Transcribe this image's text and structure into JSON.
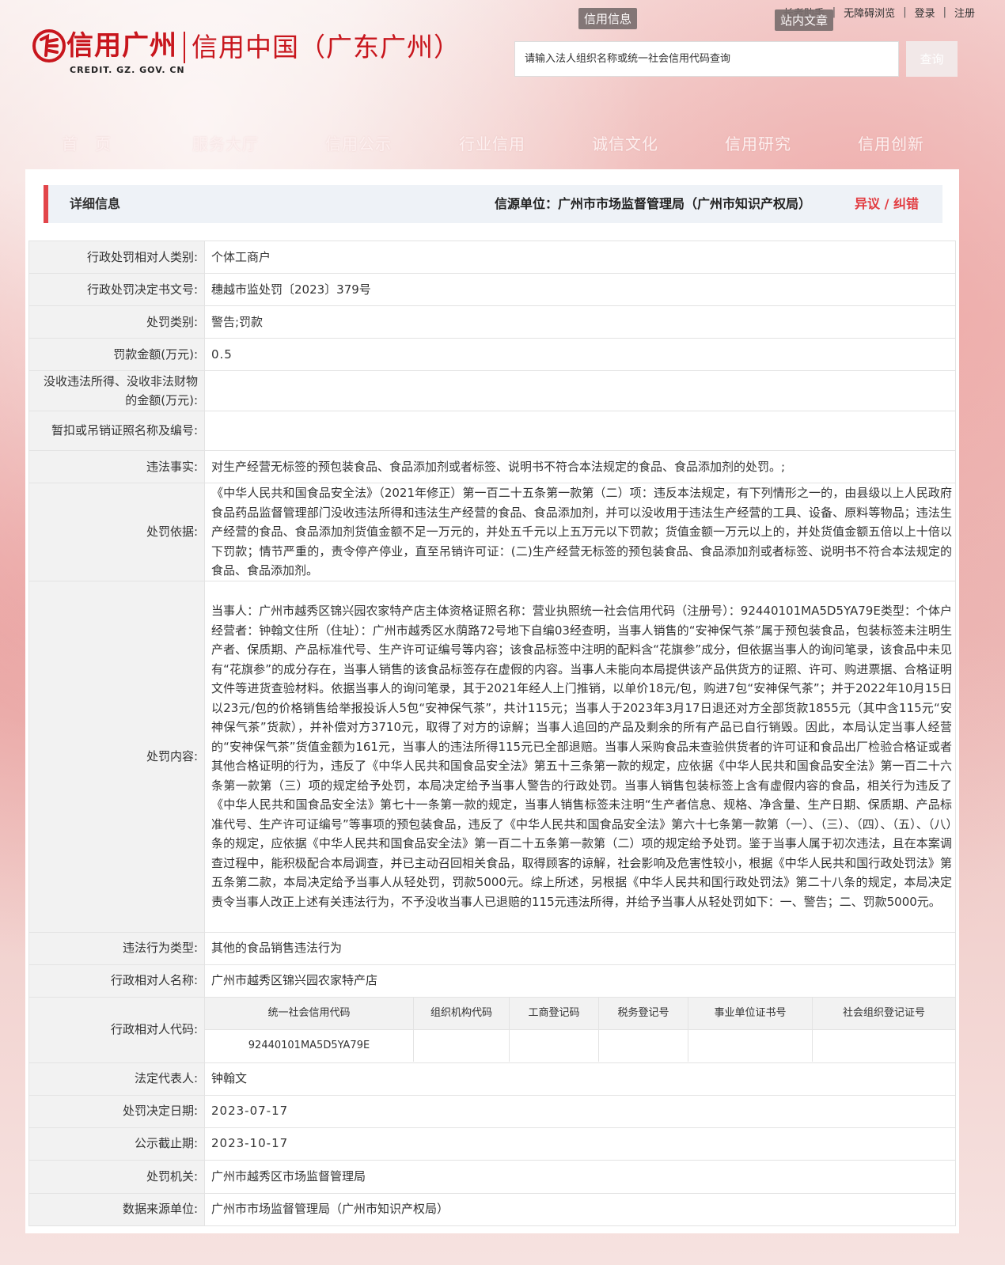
{
  "top_links": {
    "elder": "长者助手",
    "barrier_free": "无障碍浏览",
    "login": "登录",
    "register": "注册"
  },
  "tags": {
    "credit_info": "信用信息",
    "site_article": "站内文章"
  },
  "logo": {
    "cn": "信用广州",
    "en": "CREDIT. GZ. GOV. CN",
    "subtitle": "信用中国（广东广州）"
  },
  "search": {
    "placeholder": "请输入法人组织名称或统一社会信用代码查询",
    "button": "查询"
  },
  "nav": [
    "首　页",
    "服务大厅",
    "信用公示",
    "行业信用",
    "诚信文化",
    "信用研究",
    "信用创新"
  ],
  "header": {
    "title": "详细信息",
    "source": "信源单位：广州市市场监督管理局（广州市知识产权局）",
    "objection": "异议 / 纠错"
  },
  "rows": {
    "r1": {
      "label": "行政处罚相对人类别:",
      "value": "个体工商户"
    },
    "r2": {
      "label": "行政处罚决定书文号:",
      "value": "穗越市监处罚〔2023〕379号"
    },
    "r3": {
      "label": "处罚类别:",
      "value": "警告;罚款"
    },
    "r4": {
      "label": "罚款金额(万元):",
      "value": "0.5"
    },
    "r5": {
      "label": "没收违法所得、没收非法财物的金额(万元):",
      "value": ""
    },
    "r6": {
      "label": "暂扣或吊销证照名称及编号:",
      "value": ""
    },
    "r7": {
      "label": "违法事实:",
      "value": "对生产经营无标签的预包装食品、食品添加剂或者标签、说明书不符合本法规定的食品、食品添加剂的处罚。;"
    },
    "r8": {
      "label": "处罚依据:",
      "value": "《中华人民共和国食品安全法》（2021年修正）第一百二十五条第一款第（二）项：违反本法规定，有下列情形之一的，由县级以上人民政府食品药品监督管理部门没收违法所得和违法生产经营的食品、食品添加剂，并可以没收用于违法生产经营的工具、设备、原料等物品；违法生产经营的食品、食品添加剂货值金额不足一万元的，并处五千元以上五万元以下罚款；货值金额一万元以上的，并处货值金额五倍以上十倍以下罚款；情节严重的，责令停产停业，直至吊销许可证：(二)生产经营无标签的预包装食品、食品添加剂或者标签、说明书不符合本法规定的食品、食品添加剂。"
    },
    "r9": {
      "label": "处罚内容:",
      "value": "当事人：广州市越秀区锦兴园农家特产店主体资格证照名称：营业执照统一社会信用代码（注册号）：92440101MA5D5YA79E类型：个体户经营者：钟翰文住所（住址）：广州市越秀区水荫路72号地下自编03经查明，当事人销售的“安神保气茶”属于预包装食品，包装标签未注明生产者、保质期、产品标准代号、生产许可证编号等内容；该食品标签中注明的配料含“花旗参”成分，但依据当事人的询问笔录，该食品中未见有“花旗参”的成分存在，当事人销售的该食品标签存在虚假的内容。当事人未能向本局提供该产品供货方的证照、许可、购进票据、合格证明文件等进货查验材料。依据当事人的询问笔录，其于2021年经人上门推销，以单价18元/包，购进7包“安神保气茶”；并于2022年10月15日以23元/包的价格销售给举报投诉人5包“安神保气茶”，共计115元；当事人于2023年3月17日退还对方全部货款1855元（其中含115元“安神保气茶”货款），并补偿对方3710元，取得了对方的谅解；当事人追回的产品及剩余的所有产品已自行销毁。因此，本局认定当事人经营的“安神保气茶”货值金额为161元，当事人的违法所得115元已全部退赔。当事人采购食品未查验供货者的许可证和食品出厂检验合格证或者其他合格证明的行为，违反了《中华人民共和国食品安全法》第五十三条第一款的规定，应依据《中华人民共和国食品安全法》第一百二十六条第一款第（三）项的规定给予处罚，本局决定给予当事人警告的行政处罚。当事人销售包装标签上含有虚假内容的食品，相关行为违反了《中华人民共和国食品安全法》第七十一条第一款的规定，当事人销售标签未注明“生产者信息、规格、净含量、生产日期、保质期、产品标准代号、生产许可证编号”等事项的预包装食品，违反了《中华人民共和国食品安全法》第六十七条第一款第（一）、（三）、（四）、（五）、（八）条的规定，应依据《中华人民共和国食品安全法》第一百二十五条第一款第（二）项的规定给予处罚。鉴于当事人属于初次违法，且在本案调查过程中，能积极配合本局调查，并已主动召回相关食品，取得顾客的谅解，社会影响及危害性较小，根据《中华人民共和国行政处罚法》第五条第二款，本局决定给予当事人从轻处罚，罚款5000元。综上所述，另根据《中华人民共和国行政处罚法》第二十八条的规定，本局决定责令当事人改正上述有关违法行为，不予没收当事人已退赔的115元违法所得，并给予当事人从轻处罚如下：一、警告；二、罚款5000元。"
    },
    "r10": {
      "label": "违法行为类型:",
      "value": "其他的食品销售违法行为"
    },
    "r11": {
      "label": "行政相对人名称:",
      "value": "广州市越秀区锦兴园农家特产店"
    },
    "r12": {
      "label": "行政相对人代码:"
    },
    "r13": {
      "label": "法定代表人:",
      "value": "钟翰文"
    },
    "r14": {
      "label": "处罚决定日期:",
      "value": "2023-07-17"
    },
    "r15": {
      "label": "公示截止期:",
      "value": "2023-10-17"
    },
    "r16": {
      "label": "处罚机关:",
      "value": "广州市越秀区市场监督管理局"
    },
    "r17": {
      "label": "数据来源单位:",
      "value": "广州市市场监督管理局（广州市知识产权局）"
    }
  },
  "codes": {
    "headers": [
      "统一社会信用代码",
      "组织机构代码",
      "工商登记码",
      "税务登记号",
      "事业单位证书号",
      "社会组织登记证号"
    ],
    "values": [
      "92440101MA5D5YA79E",
      "",
      "",
      "",
      "",
      ""
    ]
  },
  "colors": {
    "brand_red": "#c8161d",
    "accent_red": "#e2454a"
  }
}
